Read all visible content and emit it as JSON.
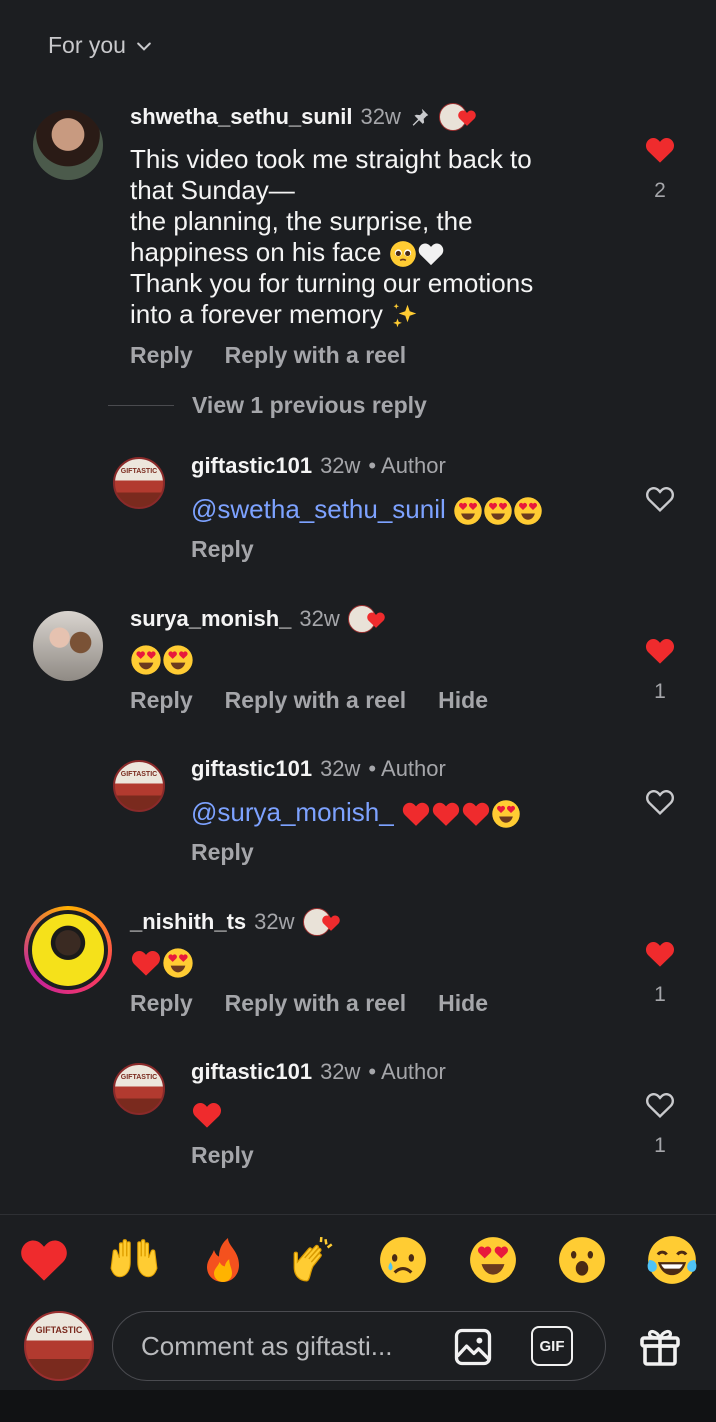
{
  "header": {
    "sort_label": "For you"
  },
  "comments": [
    {
      "username": "shwetha_sethu_sunil",
      "time": "32w",
      "text_lines": [
        "This video took me straight back to",
        "that Sunday—",
        "the planning, the surprise, the",
        "happiness on his face",
        "Thank you for turning our emotions",
        "into a forever memory"
      ],
      "likes": "2",
      "actions": [
        "Reply",
        "Reply with a reel"
      ]
    },
    {
      "username": "surya_monish_",
      "time": "32w",
      "likes": "1",
      "actions": [
        "Reply",
        "Reply with a reel",
        "Hide"
      ]
    },
    {
      "username": "_nishith_ts",
      "time": "32w",
      "likes": "1",
      "actions": [
        "Reply",
        "Reply with a reel",
        "Hide"
      ]
    }
  ],
  "view_previous": "View 1 previous reply",
  "replies": [
    {
      "username": "giftastic101",
      "time": "32w",
      "author_tag": "• Author",
      "mention": "@swetha_sethu_sunil",
      "reply_label": "Reply"
    },
    {
      "username": "giftastic101",
      "time": "32w",
      "author_tag": "• Author",
      "mention": "@surya_monish_",
      "reply_label": "Reply"
    },
    {
      "username": "giftastic101",
      "time": "32w",
      "author_tag": "• Author",
      "reply_label": "Reply",
      "likes": "1"
    }
  ],
  "avatar_logo_text": "GIFTASTIC",
  "composer": {
    "placeholder": "Comment as giftasti...",
    "gif_label": "GIF"
  },
  "reactions": [
    "heart",
    "raising-hands",
    "fire",
    "clapping-hands",
    "sad-face",
    "heart-eyes",
    "surprised-face",
    "tears-of-joy"
  ],
  "colors": {
    "like_red": "#ff3040",
    "mention_blue": "#7da2ff",
    "background": "#1c1e21"
  }
}
